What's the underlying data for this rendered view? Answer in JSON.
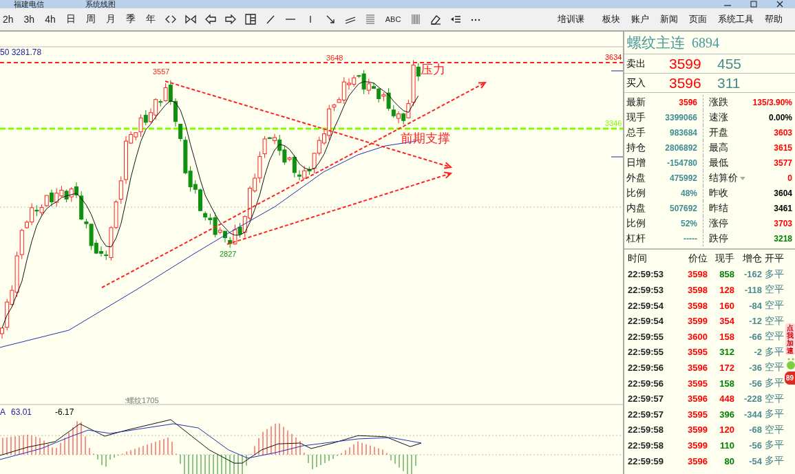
{
  "title_bar": {
    "texts": [
      "福建电信",
      "系统线图"
    ]
  },
  "toolbar": {
    "periods": [
      {
        "label": "2h"
      },
      {
        "label": "3h"
      },
      {
        "label": "4h"
      },
      {
        "label": "日"
      },
      {
        "label": "周"
      },
      {
        "label": "月"
      },
      {
        "label": "季"
      },
      {
        "label": "年"
      }
    ],
    "text_tool": "ABC",
    "menu": [
      "培训课",
      "板块",
      "账户",
      "新闻",
      "页面",
      "系统工具",
      "帮助"
    ]
  },
  "chart": {
    "ma_readout": "50 3281.78",
    "annotations": [
      {
        "text": "3557",
        "kind": "price"
      },
      {
        "text": "3648",
        "kind": "price"
      },
      {
        "text": "2827",
        "kind": "price"
      },
      {
        "text": "压力",
        "kind": "note"
      },
      {
        "text": "前期支撑",
        "kind": "note"
      }
    ],
    "axis_labels": [
      "3634",
      "3346"
    ],
    "contract": ":螺纹1705",
    "indicator_readouts": [
      "A",
      "63.01",
      "-6.17"
    ]
  },
  "quote": {
    "name": "螺纹主连",
    "code": "6894",
    "ask": {
      "label": "卖出",
      "price": "3599",
      "volume": "455"
    },
    "bid": {
      "label": "买入",
      "price": "3596",
      "volume": "311"
    },
    "stats": [
      [
        {
          "label": "最新",
          "value": "3596",
          "color": "#ff0000"
        },
        {
          "label": "涨跌",
          "value": "135/3.90%",
          "color": "#ff0000"
        }
      ],
      [
        {
          "label": "现手",
          "value": "3399066",
          "color": "#3f8c95"
        },
        {
          "label": "速涨",
          "value": "0.00%",
          "color": "#000000"
        }
      ],
      [
        {
          "label": "总手",
          "value": "983684",
          "color": "#3f8c95"
        },
        {
          "label": "开盘",
          "value": "3603",
          "color": "#ff0000"
        }
      ],
      [
        {
          "label": "持仓",
          "value": "2806892",
          "color": "#3f8c95"
        },
        {
          "label": "最高",
          "value": "3615",
          "color": "#ff0000"
        }
      ],
      [
        {
          "label": "日增",
          "value": "-154780",
          "color": "#3f8c95"
        },
        {
          "label": "最低",
          "value": "3577",
          "color": "#ff0000"
        }
      ],
      [
        {
          "label": "外盘",
          "value": "475992",
          "color": "#3f8c95"
        },
        {
          "label": "结算价",
          "value": "0",
          "color": "#ff0000",
          "dropdown": true
        }
      ],
      [
        {
          "label": "比例",
          "value": "48%",
          "color": "#3f8c95"
        },
        {
          "label": "昨收",
          "value": "3604",
          "color": "#000000"
        }
      ],
      [
        {
          "label": "内盘",
          "value": "507692",
          "color": "#3f8c95"
        },
        {
          "label": "昨结",
          "value": "3461",
          "color": "#000000"
        }
      ],
      [
        {
          "label": "比例",
          "value": "52%",
          "color": "#3f8c95"
        },
        {
          "label": "涨停",
          "value": "3703",
          "color": "#ff0000"
        }
      ],
      [
        {
          "label": "杠杆",
          "value": "-----",
          "color": "#3f8c95"
        },
        {
          "label": "跌停",
          "value": "3218",
          "color": "#008000"
        }
      ]
    ]
  },
  "trades": {
    "columns": [
      "时间",
      "价位",
      "现手",
      "增仓",
      "开平"
    ],
    "rows": [
      {
        "time": "22:59:53",
        "price": "3598",
        "volume": "858",
        "change": "-162",
        "side": "多平",
        "color": "#008000"
      },
      {
        "time": "22:59:53",
        "price": "3598",
        "volume": "128",
        "change": "-118",
        "side": "空平",
        "color": "#ff0000"
      },
      {
        "time": "22:59:54",
        "price": "3598",
        "volume": "160",
        "change": "-84",
        "side": "空平",
        "color": "#ff0000"
      },
      {
        "time": "22:59:54",
        "price": "3599",
        "volume": "354",
        "change": "-12",
        "side": "空平",
        "color": "#ff0000"
      },
      {
        "time": "22:59:55",
        "price": "3600",
        "volume": "158",
        "change": "-66",
        "side": "空平",
        "color": "#ff0000"
      },
      {
        "time": "22:59:55",
        "price": "3595",
        "volume": "312",
        "change": "-2",
        "side": "多平",
        "color": "#008000"
      },
      {
        "time": "22:59:56",
        "price": "3596",
        "volume": "172",
        "change": "-36",
        "side": "空平",
        "color": "#ff0000"
      },
      {
        "time": "22:59:56",
        "price": "3595",
        "volume": "158",
        "change": "-56",
        "side": "多平",
        "color": "#008000"
      },
      {
        "time": "22:59:57",
        "price": "3596",
        "volume": "448",
        "change": "-228",
        "side": "空平",
        "color": "#ff0000"
      },
      {
        "time": "22:59:57",
        "price": "3595",
        "volume": "396",
        "change": "-344",
        "side": "多平",
        "color": "#008000"
      },
      {
        "time": "22:59:58",
        "price": "3599",
        "volume": "120",
        "change": "-68",
        "side": "空平",
        "color": "#ff0000"
      },
      {
        "time": "22:59:58",
        "price": "3599",
        "volume": "110",
        "change": "-56",
        "side": "多平",
        "color": "#008000"
      },
      {
        "time": "22:59:59",
        "price": "3596",
        "volume": "80",
        "change": "-54",
        "side": "多平",
        "color": "#008000"
      }
    ]
  },
  "widget": {
    "label": "点我加速",
    "count": "89"
  }
}
